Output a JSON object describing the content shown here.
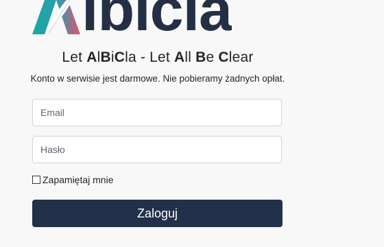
{
  "logo": {
    "wordmark": "lbicla"
  },
  "slogan": {
    "part1": "Let ",
    "a1": "A",
    "l1": "l",
    "b1": "B",
    "i1": "i",
    "c1": "C",
    "la": "la - Let ",
    "a2": "A",
    "ll": "ll ",
    "b2": "B",
    "e": "e ",
    "c2": "C",
    "lear": "lear"
  },
  "subtitle": "Konto w serwisie jest darmowe. Nie pobieramy żadnych opłat.",
  "form": {
    "email_placeholder": "Email",
    "password_placeholder": "Hasło",
    "remember_label": "Zapamiętaj mnie",
    "remember_checked": false,
    "submit_label": "Zaloguj"
  },
  "colors": {
    "brand_dark": "#223149",
    "logo_teal": "#1aa9a0",
    "logo_pink": "#e8516b"
  }
}
